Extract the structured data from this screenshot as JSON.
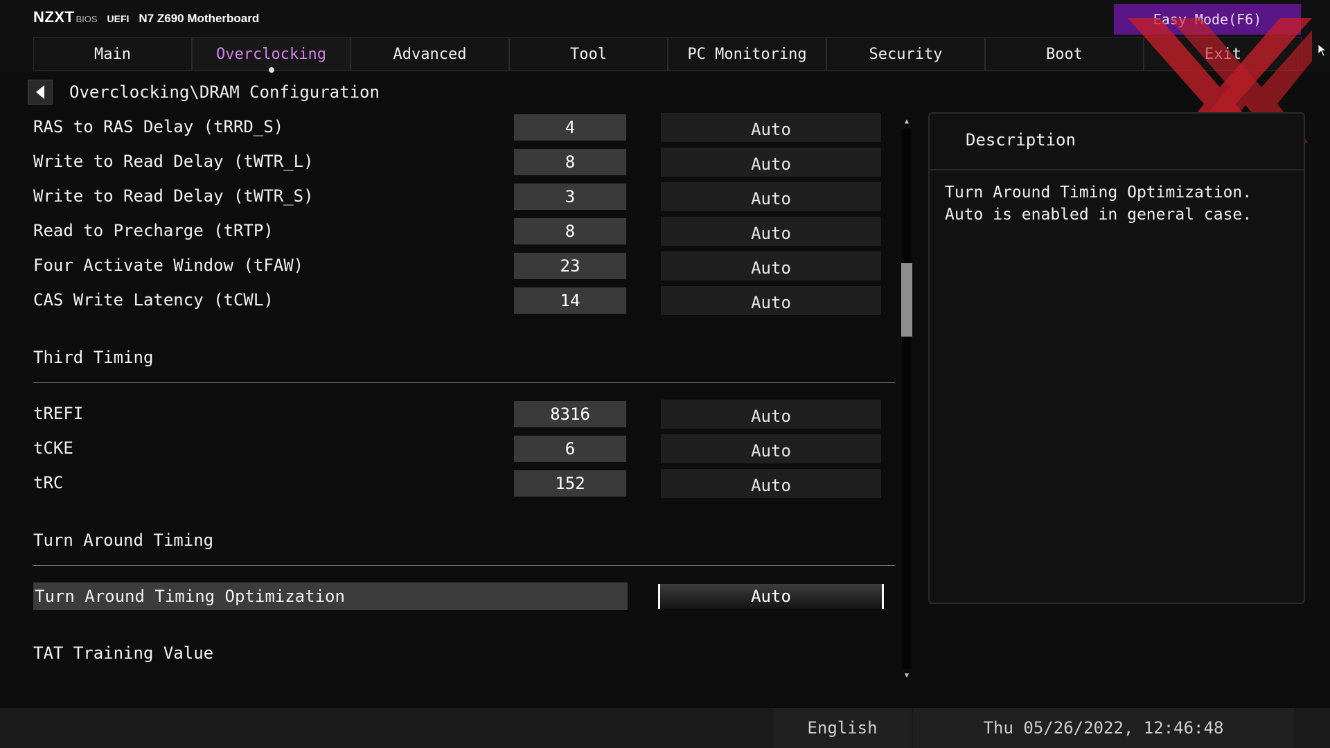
{
  "header": {
    "logo": "NZXT",
    "bios_label": "BIOS",
    "uefi_label": "UEFI",
    "board_name": "N7 Z690 Motherboard",
    "easy_mode_label": "Easy Mode(F6)"
  },
  "tabs": [
    {
      "label": "Main"
    },
    {
      "label": "Overclocking",
      "active": true
    },
    {
      "label": "Advanced"
    },
    {
      "label": "Tool"
    },
    {
      "label": "PC Monitoring"
    },
    {
      "label": "Security"
    },
    {
      "label": "Boot"
    },
    {
      "label": "Exit"
    }
  ],
  "breadcrumb": "Overclocking\\DRAM Configuration",
  "settings": {
    "trrd_s": {
      "label": "RAS to RAS Delay (tRRD_S)",
      "current": "4",
      "value": "Auto"
    },
    "twtr_l": {
      "label": "Write to Read Delay (tWTR_L)",
      "current": "8",
      "value": "Auto"
    },
    "twtr_s": {
      "label": "Write to Read Delay (tWTR_S)",
      "current": "3",
      "value": "Auto"
    },
    "trtp": {
      "label": "Read to Precharge (tRTP)",
      "current": "8",
      "value": "Auto"
    },
    "tfaw": {
      "label": "Four Activate Window (tFAW)",
      "current": "23",
      "value": "Auto"
    },
    "tcwl": {
      "label": "CAS Write Latency (tCWL)",
      "current": "14",
      "value": "Auto"
    },
    "trefi": {
      "label": "tREFI",
      "current": "8316",
      "value": "Auto"
    },
    "tcke": {
      "label": "tCKE",
      "current": "6",
      "value": "Auto"
    },
    "trc": {
      "label": "tRC",
      "current": "152",
      "value": "Auto"
    },
    "tat_opt": {
      "label": "Turn Around Timing Optimization",
      "value": "Auto"
    }
  },
  "sections": {
    "third_timing": "Third Timing",
    "turn_around_timing": "Turn Around Timing",
    "tat_training_value": "TAT Training Value"
  },
  "description": {
    "title": "Description",
    "line1": "Turn Around Timing Optimization.",
    "line2": "Auto is enabled in general case."
  },
  "footer": {
    "language": "English",
    "datetime": "Thu 05/26/2022, 12:46:48"
  },
  "colors": {
    "accent_tab": "#d580e8",
    "easy_mode_bg": "#5a1687",
    "watermark": "#c8202a"
  }
}
